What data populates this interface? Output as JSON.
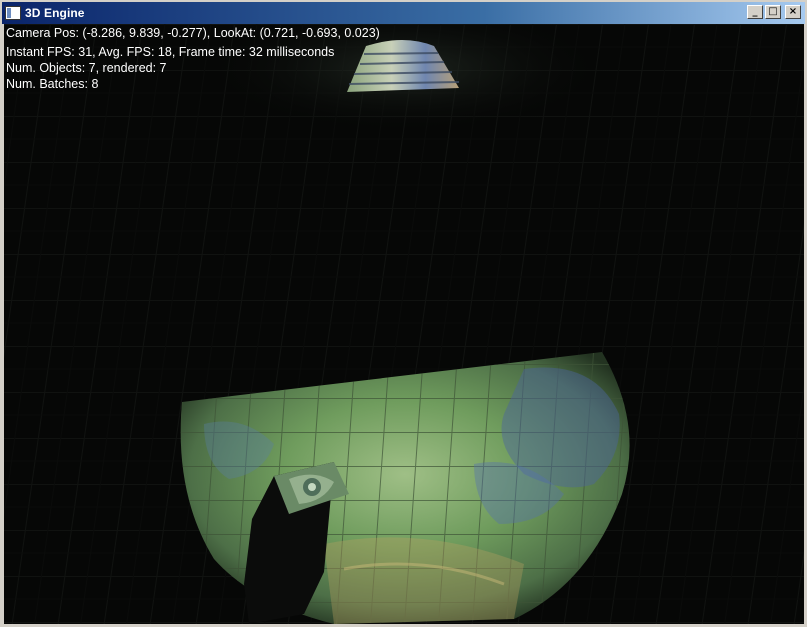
{
  "window": {
    "title": "3D Engine",
    "buttons": {
      "minimize": "_",
      "maximize": "□",
      "close": "×"
    }
  },
  "hud": {
    "camera": "Camera Pos: (-8.286, 9.839, -0.277), LookAt: (0.721, -0.693, 0.023)",
    "fps": "Instant FPS: 31, Avg. FPS: 18, Frame time: 32 milliseconds",
    "objects": "Num. Objects: 7, rendered: 7",
    "batches": "Num. Batches: 8"
  },
  "colors": {
    "titlebar_start": "#0a246a",
    "titlebar_end": "#a6caf0",
    "hud_text": "#ffffff",
    "scene_bg": "#060706"
  }
}
